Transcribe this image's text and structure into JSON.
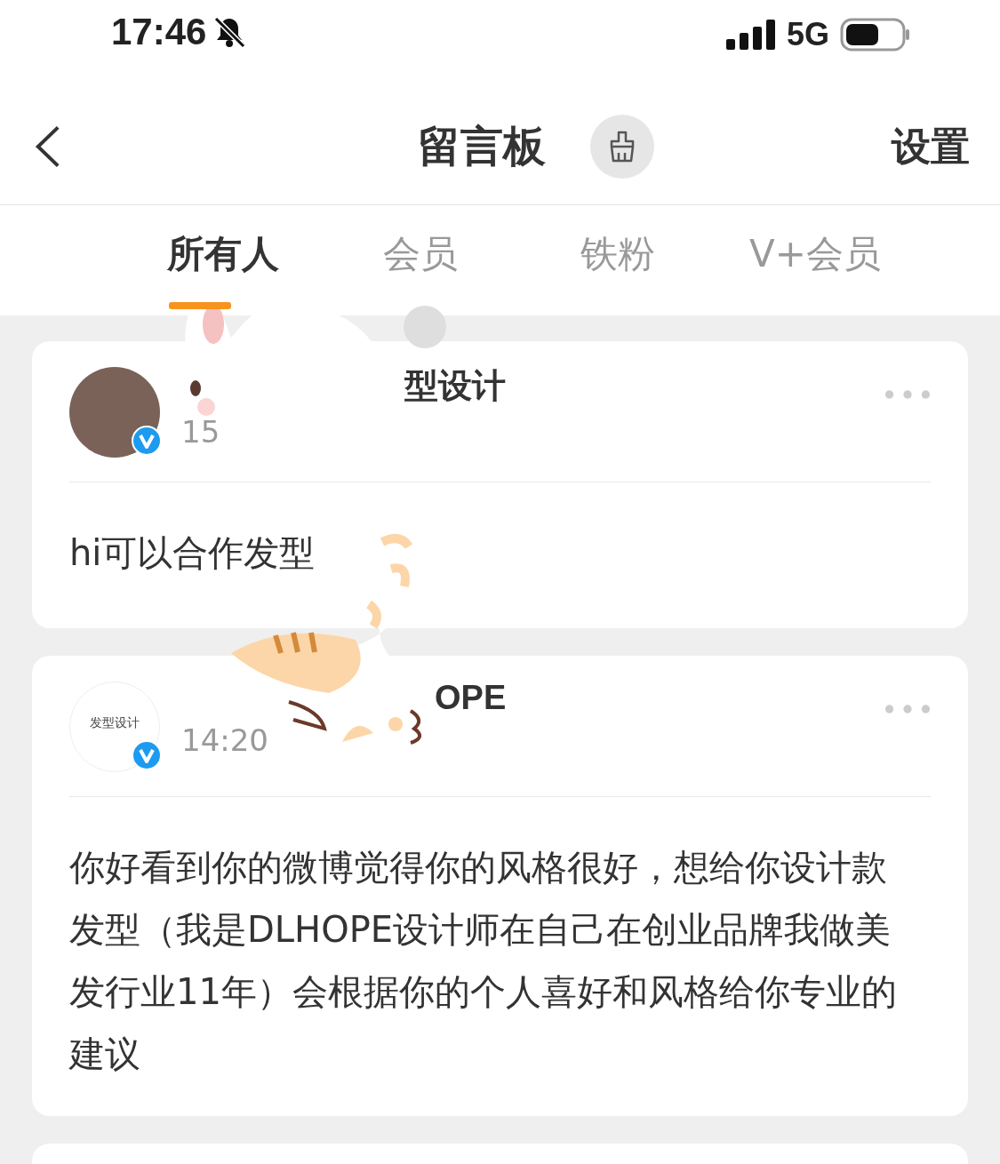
{
  "status_bar": {
    "time": "17:46",
    "network": "5G"
  },
  "nav": {
    "title": "留言板",
    "action": "设置"
  },
  "tabs": [
    {
      "label": "所有人",
      "selected": true
    },
    {
      "label": "会员",
      "selected": false
    },
    {
      "label": "铁粉",
      "selected": false
    },
    {
      "label": "V+会员",
      "selected": false
    }
  ],
  "messages": [
    {
      "name": "型设计",
      "time": "15",
      "verified": true,
      "text": "hi可以合作发型"
    },
    {
      "avatar_text": "发型设计",
      "name": "OPE",
      "time": "14:20",
      "verified": true,
      "text": "你好看到你的微博觉得你的风格很好，想给你设计款发型（我是DLHOPE设计师在自己在创业品牌我做美发行业11年）会根据你的个人喜好和风格给你专业的建议"
    }
  ]
}
